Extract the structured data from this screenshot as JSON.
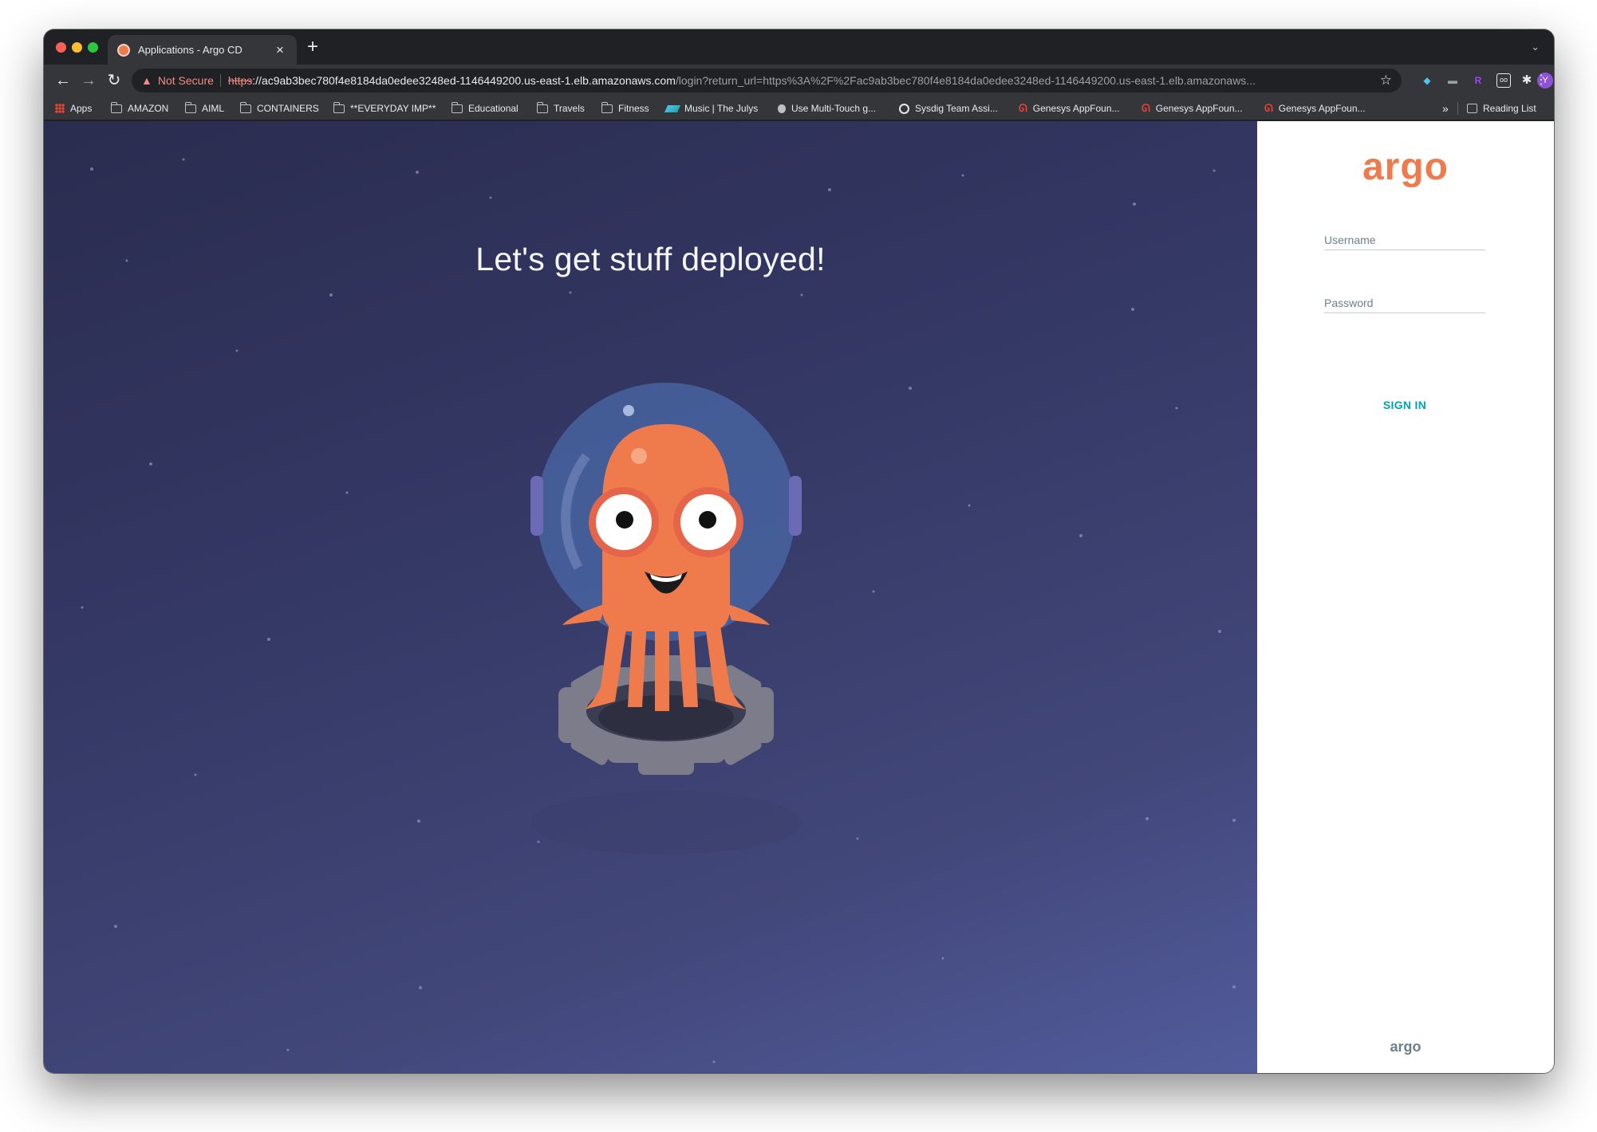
{
  "browser": {
    "tab": {
      "title": "Applications - Argo CD",
      "close": "×"
    },
    "new_tab": "+",
    "tab_search": "⌄",
    "nav": {
      "back": "←",
      "forward": "→",
      "reload": "↻"
    },
    "address": {
      "security_label": "Not Secure",
      "scheme": "https",
      "scheme_sep": "://",
      "host": "ac9ab3bec780f4e8184da0edee3248ed-1146449200.us-east-1.elb.amazonaws.com",
      "path": "/login?return_url=https%3A%2F%2Fac9ab3bec780f4e8184da0edee3248ed-1146449200.us-east-1.elb.amazonaws..."
    },
    "profile_initial": "Y",
    "bookmarks": [
      {
        "label": "Apps",
        "icon": "apps-grid-icon"
      },
      {
        "label": "AMAZON",
        "icon": "folder-icon"
      },
      {
        "label": "AIML",
        "icon": "folder-icon"
      },
      {
        "label": "CONTAINERS",
        "icon": "folder-icon"
      },
      {
        "label": "**EVERYDAY IMP**",
        "icon": "folder-icon"
      },
      {
        "label": "Educational",
        "icon": "folder-icon"
      },
      {
        "label": "Travels",
        "icon": "folder-icon"
      },
      {
        "label": "Fitness",
        "icon": "folder-icon"
      },
      {
        "label": "Music | The Julys",
        "icon": "music-site-icon"
      },
      {
        "label": "Use Multi-Touch g...",
        "icon": "apple-icon"
      },
      {
        "label": "Sysdig Team Assi...",
        "icon": "globe-icon"
      },
      {
        "label": "Genesys AppFoun...",
        "icon": "genesys-icon"
      },
      {
        "label": "Genesys AppFoun...",
        "icon": "genesys-icon"
      },
      {
        "label": "Genesys AppFoun...",
        "icon": "genesys-icon"
      }
    ],
    "bookmarks_overflow": "»",
    "reading_list": "Reading List"
  },
  "hero": {
    "title": "Let's get stuff deployed!"
  },
  "login": {
    "brand": "argo",
    "username_placeholder": "Username",
    "password_placeholder": "Password",
    "sign_in_label": "SIGN IN",
    "footer_brand": "argo"
  },
  "colors": {
    "accent_orange": "#ef7b4d",
    "sign_in_teal": "#00a2b3",
    "hero_background": "#343864"
  }
}
